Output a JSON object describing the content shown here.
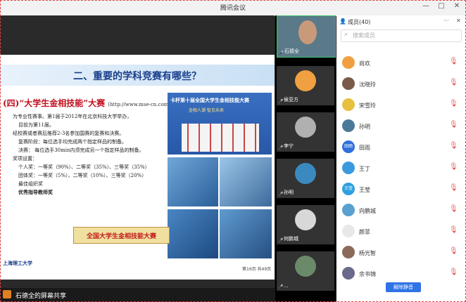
{
  "window": {
    "title": "腾讯会议",
    "minimize": "—",
    "maximize": "□",
    "close": "✕",
    "panel_more": "···",
    "panel_close": "✕"
  },
  "slide": {
    "title": "二、重要的学科竞赛有哪些？",
    "section_title": "(四)“大学生金相技能”大赛",
    "section_url": "(http://www.mse-cn.com/)",
    "lines": [
      "为专业性赛事。第1届于2012年在北京科技大学举办，",
      "目前为第11届。",
      "经校赛或者赛后推荐2-3名参加国赛的复赛和决赛。",
      "复赛阶段：每位选手均完成两个指定样品的制备。",
      "决赛：    每位选手30min内须完成另一个指定样品的制备。",
      "奖项设置：",
      "个人奖：一等奖（90%）、二等奖（35%）、三等奖（35%）",
      "团体奖：一等奖（5%）、二等奖（10%）、三等奖（20%）",
      "最佳组织奖",
      "优秀指导教师奖"
    ],
    "photo_banner_text": "卡杯第十届全国大学生金相技能大赛",
    "photo_banner_sub": "金相人潮  智见未来",
    "red_banner": "全国大学生金相技能大赛",
    "university_logo": "上海理工大学",
    "page_number": "第16页 共49页"
  },
  "share_bar": {
    "label": "石德全的屏幕共享"
  },
  "video_tiles": [
    {
      "name": "石德全",
      "mic": "🎤"
    },
    {
      "name": "侯亚方",
      "mic": "🎤"
    },
    {
      "name": "李宁",
      "mic": "🎤"
    },
    {
      "name": "孙明",
      "mic": "🎤"
    },
    {
      "name": "何鹏城",
      "mic": "🎤"
    },
    {
      "name": "...",
      "mic": "🎤"
    }
  ],
  "members_panel": {
    "title": "成员(40)",
    "search_placeholder": "搜索成员",
    "members": [
      {
        "name": "尚欢",
        "avatar_text": ""
      },
      {
        "name": "沈晓玲",
        "avatar_text": ""
      },
      {
        "name": "宋雪玲",
        "avatar_text": ""
      },
      {
        "name": "孙明",
        "avatar_text": ""
      },
      {
        "name": "田雨",
        "avatar_text": "田雨"
      },
      {
        "name": "王丁",
        "avatar_text": ""
      },
      {
        "name": "王莹",
        "avatar_text": "王莹"
      },
      {
        "name": "向鹏城",
        "avatar_text": ""
      },
      {
        "name": "颜菲",
        "avatar_text": ""
      },
      {
        "name": "杨光智",
        "avatar_text": ""
      },
      {
        "name": "余书锦",
        "avatar_text": ""
      }
    ],
    "mic_icon": "🎙",
    "unmute_all_button": "解除静音"
  }
}
